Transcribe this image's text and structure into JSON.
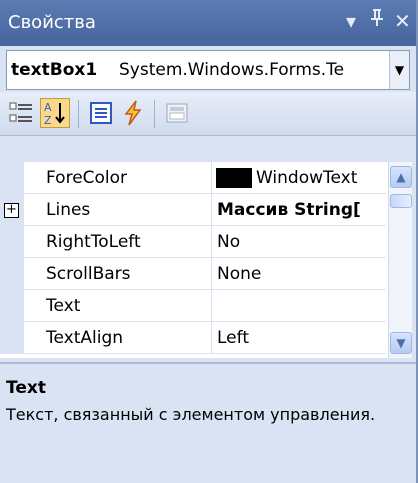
{
  "window": {
    "title": "Свойства"
  },
  "title_buttons": [
    {
      "name": "dropdown-arrow-icon",
      "glyph": "▾"
    },
    {
      "name": "pin-icon",
      "glyph": "ᵁ"
    },
    {
      "name": "close-icon",
      "glyph": "✕"
    }
  ],
  "object_selector": {
    "object_name": "textBox1",
    "object_type": "System.Windows.Forms.Te"
  },
  "toolbar": {
    "buttons": [
      "categorized-icon",
      "alphabetical-icon",
      "properties-icon",
      "events-icon",
      "property-pages-icon"
    ],
    "pressed": "alphabetical-icon"
  },
  "grid": {
    "rows": [
      {
        "name": "ForeColor",
        "value": "WindowText",
        "has_swatch": true,
        "swatch_color": "#000000"
      },
      {
        "name": "Lines",
        "value": "Массив String[",
        "expandable": true,
        "bold_value": true
      },
      {
        "name": "RightToLeft",
        "value": "No"
      },
      {
        "name": "ScrollBars",
        "value": "None"
      },
      {
        "name": "Text",
        "value": ""
      },
      {
        "name": "TextAlign",
        "value": "Left"
      }
    ]
  },
  "scrollbar": {
    "position": 0.1
  },
  "description": {
    "title": "Text",
    "text": "Текст, связанный с элементом управления."
  },
  "colors": {
    "title_bar": "#4f6ea6",
    "panel_bg": "#d9e3f4",
    "grid_bg": "#ffffff"
  }
}
